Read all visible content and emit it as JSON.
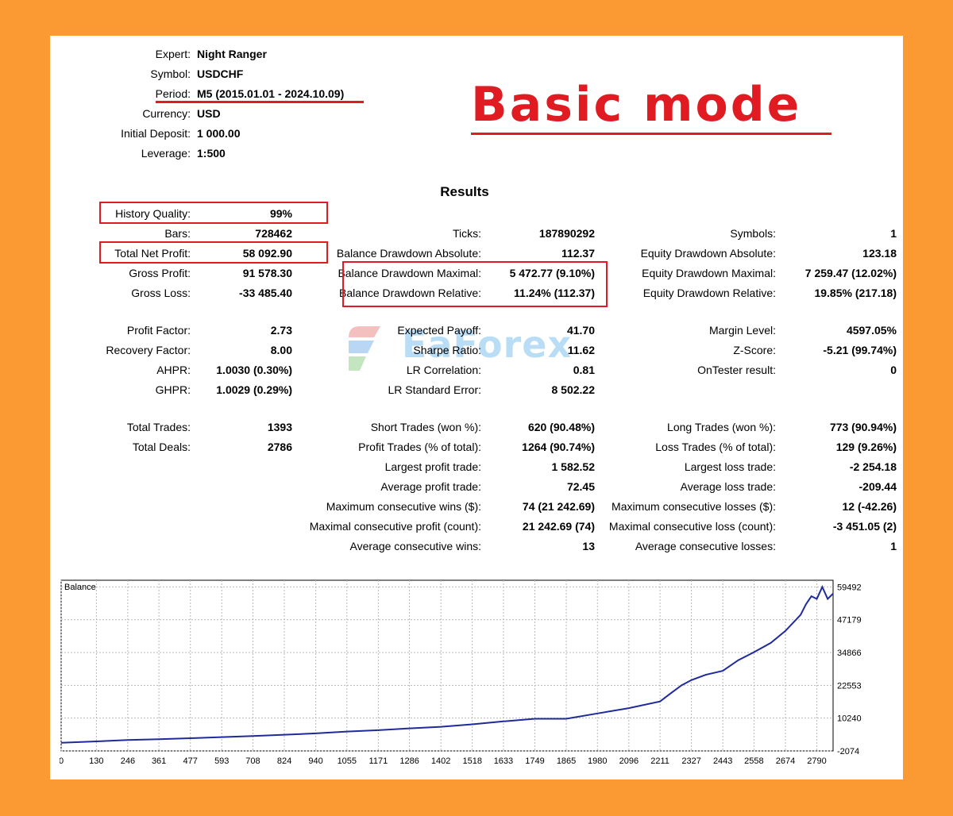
{
  "header": {
    "expert": {
      "label": "Expert:",
      "value": "Night Ranger"
    },
    "symbol": {
      "label": "Symbol:",
      "value": "USDCHF"
    },
    "period": {
      "label": "Period:",
      "value": "M5 (2015.01.01 - 2024.10.09)"
    },
    "currency": {
      "label": "Currency:",
      "value": "USD"
    },
    "initial_deposit": {
      "label": "Initial Deposit:",
      "value": "1 000.00"
    },
    "leverage": {
      "label": "Leverage:",
      "value": "1:500"
    }
  },
  "banner": {
    "text": "Basic mode"
  },
  "results_title": "Results",
  "watermark": {
    "text": "EaForex"
  },
  "col1": [
    {
      "label": "History Quality:",
      "value": "99%"
    },
    {
      "label": "Bars:",
      "value": "728462"
    },
    {
      "label": "Total Net Profit:",
      "value": "58 092.90"
    },
    {
      "label": "Gross Profit:",
      "value": "91 578.30"
    },
    {
      "label": "Gross Loss:",
      "value": "-33 485.40"
    },
    {
      "label": "Profit Factor:",
      "value": "2.73"
    },
    {
      "label": "Recovery Factor:",
      "value": "8.00"
    },
    {
      "label": "AHPR:",
      "value": "1.0030 (0.30%)"
    },
    {
      "label": "GHPR:",
      "value": "1.0029 (0.29%)"
    },
    {
      "label": "Total Trades:",
      "value": "1393"
    },
    {
      "label": "Total Deals:",
      "value": "2786"
    }
  ],
  "col2": [
    {
      "label": "Ticks:",
      "value": "187890292"
    },
    {
      "label": "Balance Drawdown Absolute:",
      "value": "112.37"
    },
    {
      "label": "Balance Drawdown Maximal:",
      "value": "5 472.77 (9.10%)"
    },
    {
      "label": "Balance Drawdown Relative:",
      "value": "11.24% (112.37)"
    },
    {
      "label": "Expected Payoff:",
      "value": "41.70"
    },
    {
      "label": "Sharpe Ratio:",
      "value": "11.62"
    },
    {
      "label": "LR Correlation:",
      "value": "0.81"
    },
    {
      "label": "LR Standard Error:",
      "value": "8 502.22"
    },
    {
      "label": "Short Trades (won %):",
      "value": "620 (90.48%)"
    },
    {
      "label": "Profit Trades (% of total):",
      "value": "1264 (90.74%)"
    },
    {
      "label": "Largest profit trade:",
      "value": "1 582.52"
    },
    {
      "label": "Average profit trade:",
      "value": "72.45"
    },
    {
      "label": "Maximum consecutive wins ($):",
      "value": "74 (21 242.69)"
    },
    {
      "label": "Maximal consecutive profit (count):",
      "value": "21 242.69 (74)"
    },
    {
      "label": "Average consecutive wins:",
      "value": "13"
    }
  ],
  "col3": [
    {
      "label": "Symbols:",
      "value": "1"
    },
    {
      "label": "Equity Drawdown Absolute:",
      "value": "123.18"
    },
    {
      "label": "Equity Drawdown Maximal:",
      "value": "7 259.47 (12.02%)"
    },
    {
      "label": "Equity Drawdown Relative:",
      "value": "19.85% (217.18)"
    },
    {
      "label": "Margin Level:",
      "value": "4597.05%"
    },
    {
      "label": "Z-Score:",
      "value": "-5.21 (99.74%)"
    },
    {
      "label": "OnTester result:",
      "value": "0"
    },
    {
      "label": "Long Trades (won %):",
      "value": "773 (90.94%)"
    },
    {
      "label": "Loss Trades (% of total):",
      "value": "129 (9.26%)"
    },
    {
      "label": "Largest loss trade:",
      "value": "-2 254.18"
    },
    {
      "label": "Average loss trade:",
      "value": "-209.44"
    },
    {
      "label": "Maximum consecutive losses ($):",
      "value": "12 (-42.26)"
    },
    {
      "label": "Maximal consecutive loss (count):",
      "value": "-3 451.05 (2)"
    },
    {
      "label": "Average consecutive losses:",
      "value": "1"
    }
  ],
  "colors": {
    "highlight": "#e01b22",
    "background": "#fb9a32",
    "line": "#1f2a9c"
  },
  "chart_data": {
    "type": "line",
    "title": "Balance",
    "xlim": [
      0,
      2850
    ],
    "ylim": [
      -2074,
      62000
    ],
    "x_ticks": [
      "0",
      "130",
      "246",
      "361",
      "477",
      "593",
      "708",
      "824",
      "940",
      "1055",
      "1171",
      "1286",
      "1402",
      "1518",
      "1633",
      "1749",
      "1865",
      "1980",
      "2096",
      "2211",
      "2327",
      "2443",
      "2558",
      "2674",
      "2790"
    ],
    "y_ticks": [
      "59492",
      "47179",
      "34866",
      "22553",
      "10240",
      "-2074"
    ],
    "grid": true,
    "series": [
      {
        "x": [
          0,
          130,
          246,
          361,
          477,
          593,
          708,
          824,
          940,
          1055,
          1171,
          1286,
          1402,
          1518,
          1633,
          1749,
          1865,
          1980,
          2096,
          2211,
          2250,
          2290,
          2327,
          2380,
          2443,
          2500,
          2558,
          2620,
          2674,
          2730,
          2750,
          2770,
          2790,
          2810,
          2830,
          2850
        ],
        "y": [
          1000,
          1500,
          2000,
          2300,
          2700,
          3100,
          3500,
          4000,
          4500,
          5200,
          5700,
          6400,
          7000,
          7900,
          9000,
          10000,
          10000,
          12000,
          14000,
          16500,
          19500,
          22500,
          24500,
          26500,
          28000,
          32000,
          35000,
          38500,
          43000,
          49000,
          53000,
          56000,
          55000,
          59492,
          55000,
          57000
        ]
      }
    ]
  }
}
